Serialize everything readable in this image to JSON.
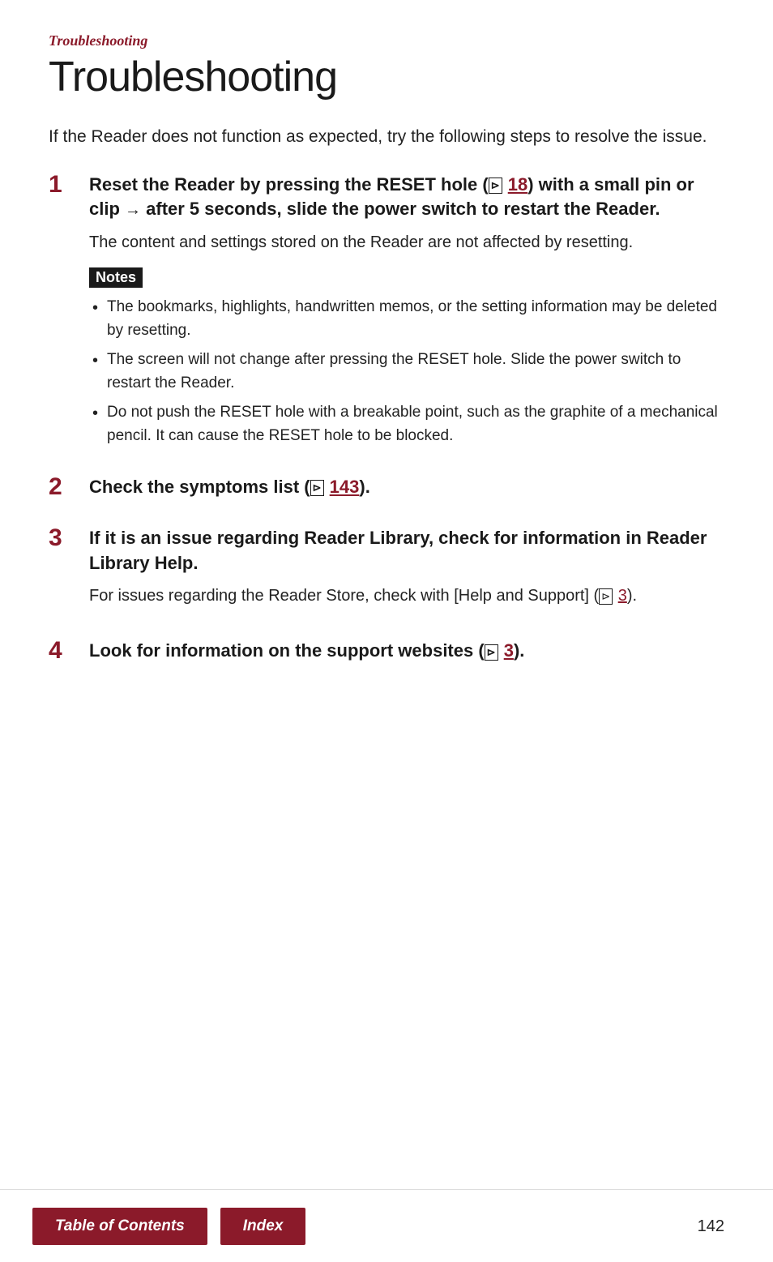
{
  "breadcrumb": "Troubleshooting",
  "page_title": "Troubleshooting",
  "intro": "If the Reader does not function as expected, try the following steps to resolve the issue.",
  "steps": [
    {
      "number": "1",
      "title_parts": [
        {
          "text": "Reset the Reader by pressing the RESET hole ("
        },
        {
          "type": "ref",
          "text": "18"
        },
        {
          "text": ") with a small pin or clip "
        },
        {
          "type": "arrow",
          "text": "→"
        },
        {
          "text": " after 5 seconds, slide the power switch to restart the Reader."
        }
      ],
      "title_plain": "Reset the Reader by pressing the RESET hole (⊳ 18) with a small pin or clip → after 5 seconds, slide the power switch to restart the Reader.",
      "desc": "The content and settings stored on the Reader are not affected by resetting.",
      "has_notes": true,
      "notes_label": "Notes",
      "notes": [
        "The bookmarks, highlights, handwritten memos, or the setting information may be deleted by resetting.",
        "The screen will not change after pressing the RESET hole. Slide the power switch to restart the Reader.",
        "Do not push the RESET hole with a breakable point, such as the graphite of a mechanical pencil. It can cause the RESET hole to be blocked."
      ]
    },
    {
      "number": "2",
      "title_plain": "Check the symptoms list (⊳ 143).",
      "title_parts": [
        {
          "text": "Check the symptoms list ("
        },
        {
          "type": "ref",
          "text": "143"
        },
        {
          "text": ")."
        }
      ],
      "desc": null,
      "has_notes": false
    },
    {
      "number": "3",
      "title_plain": "If it is an issue regarding Reader Library, check for information in Reader Library Help.",
      "title_parts": [
        {
          "text": "If it is an issue regarding Reader Library, check for information in Reader Library Help."
        }
      ],
      "desc_parts": [
        {
          "text": "For issues regarding the Reader Store, check with [Help and Support] ("
        },
        {
          "type": "ref",
          "text": "3"
        },
        {
          "text": ")."
        }
      ],
      "desc": "For issues regarding the Reader Store, check with [Help and Support] (⊳ 3).",
      "has_notes": false
    },
    {
      "number": "4",
      "title_plain": "Look for information on the support websites (⊳ 3).",
      "title_parts": [
        {
          "text": "Look for information on the support websites ("
        },
        {
          "type": "ref",
          "text": "3"
        },
        {
          "text": ")."
        }
      ],
      "desc": null,
      "has_notes": false
    }
  ],
  "footer": {
    "table_of_contents_label": "Table of Contents",
    "index_label": "Index",
    "page_number": "142"
  }
}
